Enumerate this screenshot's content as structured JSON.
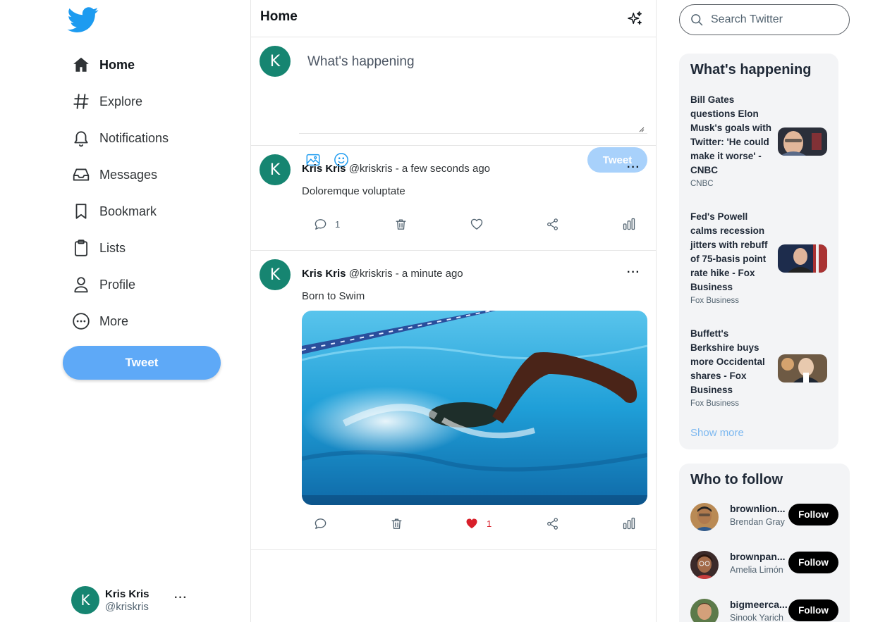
{
  "sidebar": {
    "logo": "twitter-bird-icon",
    "nav": [
      {
        "label": "Home",
        "icon": "home-icon",
        "active": true
      },
      {
        "label": "Explore",
        "icon": "hashtag-icon"
      },
      {
        "label": "Notifications",
        "icon": "bell-icon"
      },
      {
        "label": "Messages",
        "icon": "inbox-icon"
      },
      {
        "label": "Bookmark",
        "icon": "bookmark-icon"
      },
      {
        "label": "Lists",
        "icon": "clipboard-icon"
      },
      {
        "label": "Profile",
        "icon": "user-icon"
      },
      {
        "label": "More",
        "icon": "more-circle-icon"
      }
    ],
    "tweet_button": "Tweet",
    "account": {
      "initial": "K",
      "name": "Kris Kris",
      "handle": "@kriskris",
      "more": "···"
    }
  },
  "main": {
    "title": "Home",
    "composer": {
      "avatar_initial": "K",
      "placeholder": "What's happening",
      "tweet_button": "Tweet"
    },
    "posts": [
      {
        "avatar_initial": "K",
        "name": "Kris Kris",
        "meta": "@kriskris - a few seconds ago",
        "text": "Doloremque voluptate",
        "has_image": false,
        "comments": "1",
        "likes": "",
        "liked": false,
        "more": "···"
      },
      {
        "avatar_initial": "K",
        "name": "Kris Kris",
        "meta": "@kriskris - a minute ago",
        "text": "Born to Swim",
        "has_image": true,
        "image_subject": "swimmer doing freestyle in a pool",
        "comments": "",
        "likes": "1",
        "liked": true,
        "more": "···"
      }
    ]
  },
  "right": {
    "search_placeholder": "Search Twitter",
    "trends_title": "What's happening",
    "trends": [
      {
        "title": "Bill Gates questions Elon Musk's goals with Twitter: 'He could make it worse' - CNBC",
        "source": "CNBC"
      },
      {
        "title": "Fed's Powell calms recession jitters with rebuff of 75-basis point rate hike - Fox Business",
        "source": "Fox Business"
      },
      {
        "title": "Buffett's Berkshire buys more Occidental shares - Fox Business",
        "source": "Fox Business"
      }
    ],
    "show_more": "Show more",
    "follow_title": "Who to follow",
    "follow": [
      {
        "username": "brownlion...",
        "name": "Brendan Gray",
        "button": "Follow"
      },
      {
        "username": "brownpan...",
        "name": "Amelia Limón",
        "button": "Follow"
      },
      {
        "username": "bigmeerca...",
        "name": "Sinook Yarich",
        "button": "Follow"
      }
    ]
  },
  "colors": {
    "brand_blue": "#1d9bf0",
    "tweet_button": "#5ea9f7",
    "tweet_button_disabled": "#a8d1fb",
    "avatar_green": "#168571",
    "like_red": "#e0245e"
  }
}
